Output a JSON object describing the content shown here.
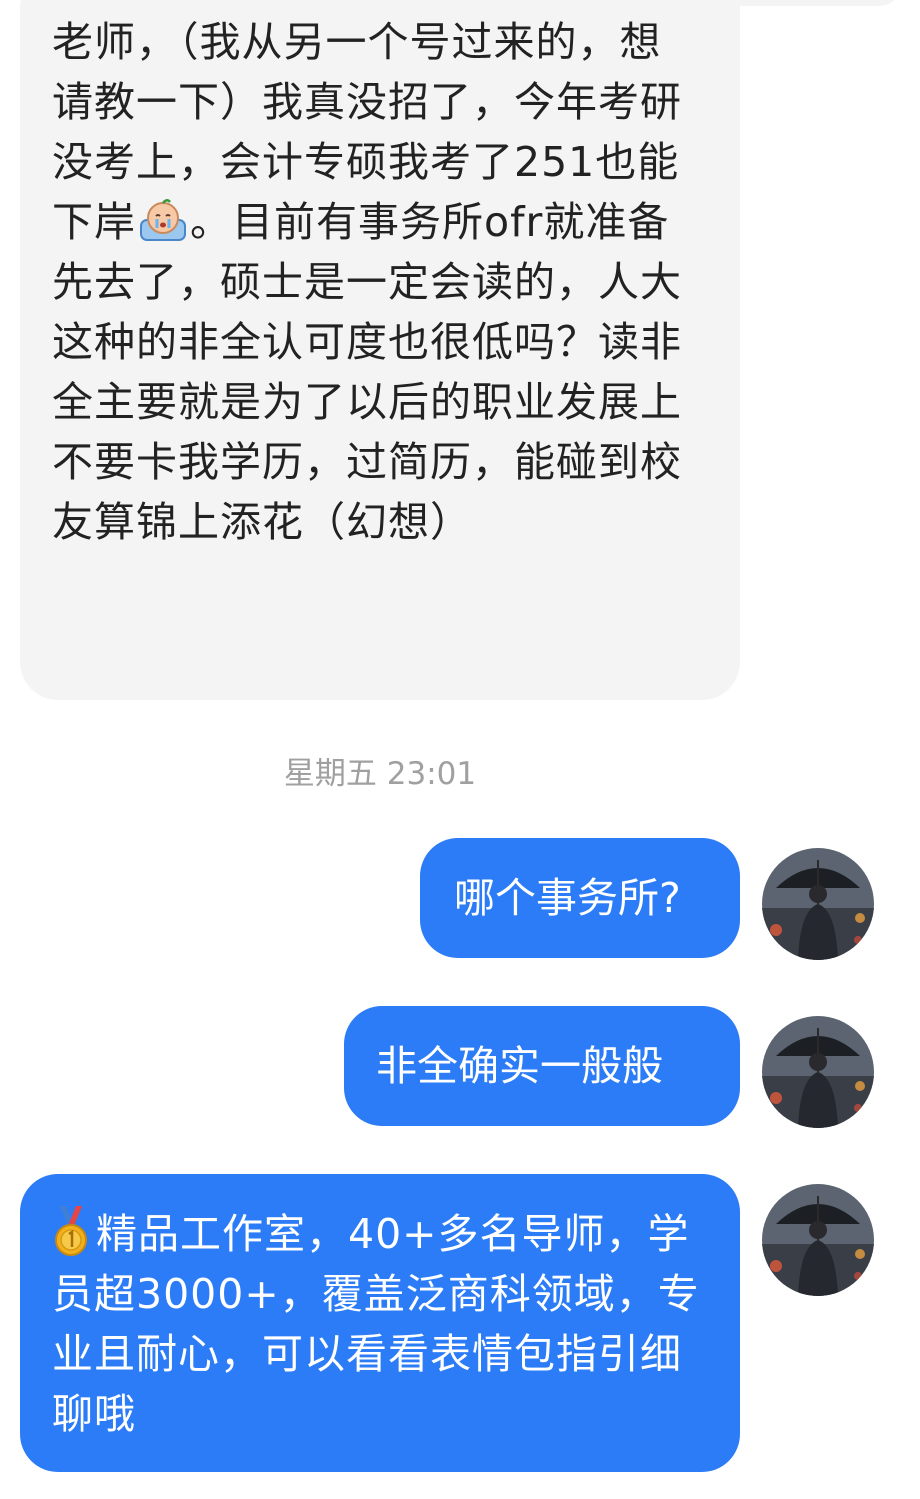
{
  "chat": {
    "incoming": {
      "text_before_emoji": "老师，（我从另一个号过来的，想请教一下）我真没招了，今年考研没考上，会计专硕我考了251也能下岸",
      "emoji": "crying-face-sticker",
      "text_after_emoji": "。目前有事务所ofr就准备先去了，硕士是一定会读的，人大这种的非全认可度也很低吗？读非全主要就是为了以后的职业发展上不要卡我学历，过简历，能碰到校友算锦上添花（幻想）"
    },
    "timestamp": "星期五 23:01",
    "outgoing": [
      {
        "text": "哪个事务所?"
      },
      {
        "text": "非全确实一般般"
      },
      {
        "icon": "gold-medal-icon",
        "text": "精品工作室，40+多名导师，学员超3000+，覆盖泛商科领域，专业且耐心，可以看看表情包指引细聊哦"
      }
    ],
    "avatar": "umbrella-man-avatar"
  },
  "colors": {
    "incoming_bubble": "#f4f4f4",
    "outgoing_bubble": "#2b7cf6",
    "timestamp": "#a0a0a0",
    "page_background": "#ffffff"
  }
}
